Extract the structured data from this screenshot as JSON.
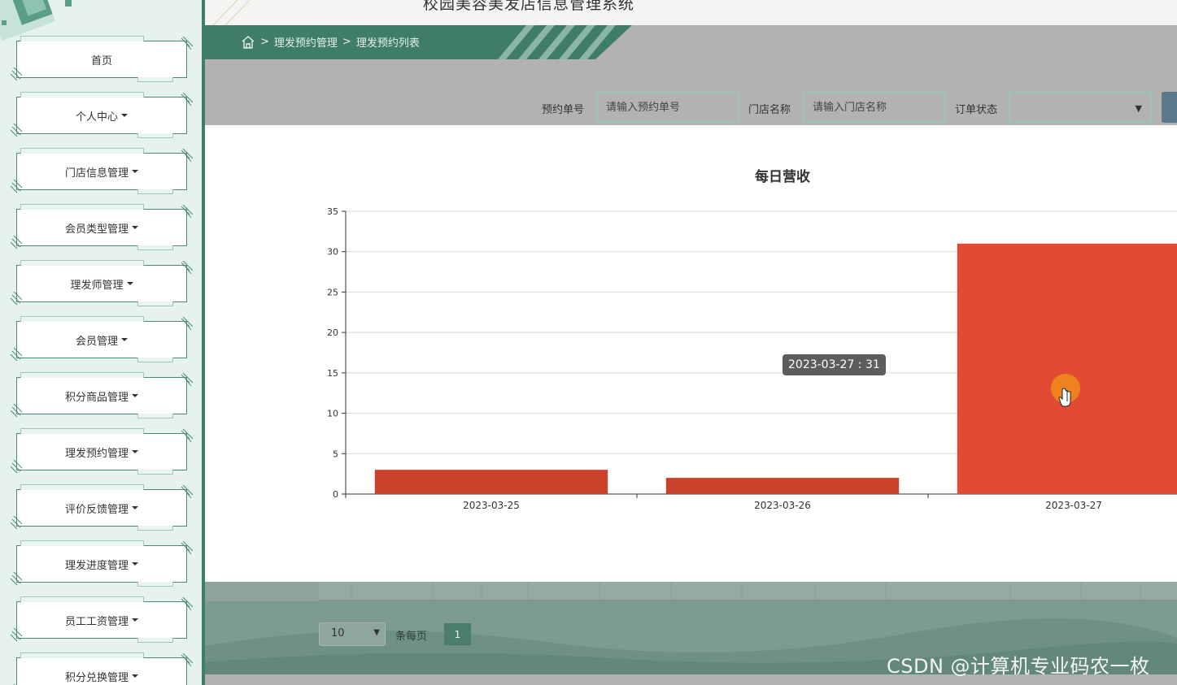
{
  "app": {
    "title": "校园美容美发店信息管理系统"
  },
  "sidebar": {
    "items": [
      {
        "label": "首页",
        "has_caret": false
      },
      {
        "label": "个人中心",
        "has_caret": true
      },
      {
        "label": "门店信息管理",
        "has_caret": true
      },
      {
        "label": "会员类型管理",
        "has_caret": true
      },
      {
        "label": "理发师管理",
        "has_caret": true
      },
      {
        "label": "会员管理",
        "has_caret": true
      },
      {
        "label": "积分商品管理",
        "has_caret": true
      },
      {
        "label": "理发预约管理",
        "has_caret": true
      },
      {
        "label": "评价反馈管理",
        "has_caret": true
      },
      {
        "label": "理发进度管理",
        "has_caret": true
      },
      {
        "label": "员工工资管理",
        "has_caret": true
      },
      {
        "label": "积分兑换管理",
        "has_caret": true
      }
    ]
  },
  "breadcrumb": {
    "sep": ">",
    "level1": "理发预约管理",
    "level2": "理发预约列表",
    "icon": "home-icon"
  },
  "search": {
    "order_no_label": "预约单号",
    "order_no_placeholder": "请输入预约单号",
    "store_label": "门店名称",
    "store_placeholder": "请输入门店名称",
    "status_label": "订单状态",
    "status_value": ""
  },
  "chart_data": {
    "type": "bar",
    "title": "每日营收",
    "categories": [
      "2023-03-25",
      "2023-03-26",
      "2023-03-27"
    ],
    "values": [
      3,
      2,
      31
    ],
    "ylim": [
      0,
      35
    ],
    "yticks": [
      0,
      5,
      10,
      15,
      20,
      25,
      30,
      35
    ],
    "grid": true,
    "colors": [
      "#cc412c",
      "#cc412c",
      "#e24a32"
    ]
  },
  "tooltip": {
    "text": "2023-03-27 : 31"
  },
  "pagination": {
    "page_size": "10",
    "per_page_label": "条每页",
    "current_page": "1"
  },
  "watermark": "CSDN @计算机专业码农一枚",
  "colors": {
    "accent_green": "#3f7d69",
    "bar_red": "#cc412c",
    "sidebar_bg": "#e6f2ee"
  }
}
